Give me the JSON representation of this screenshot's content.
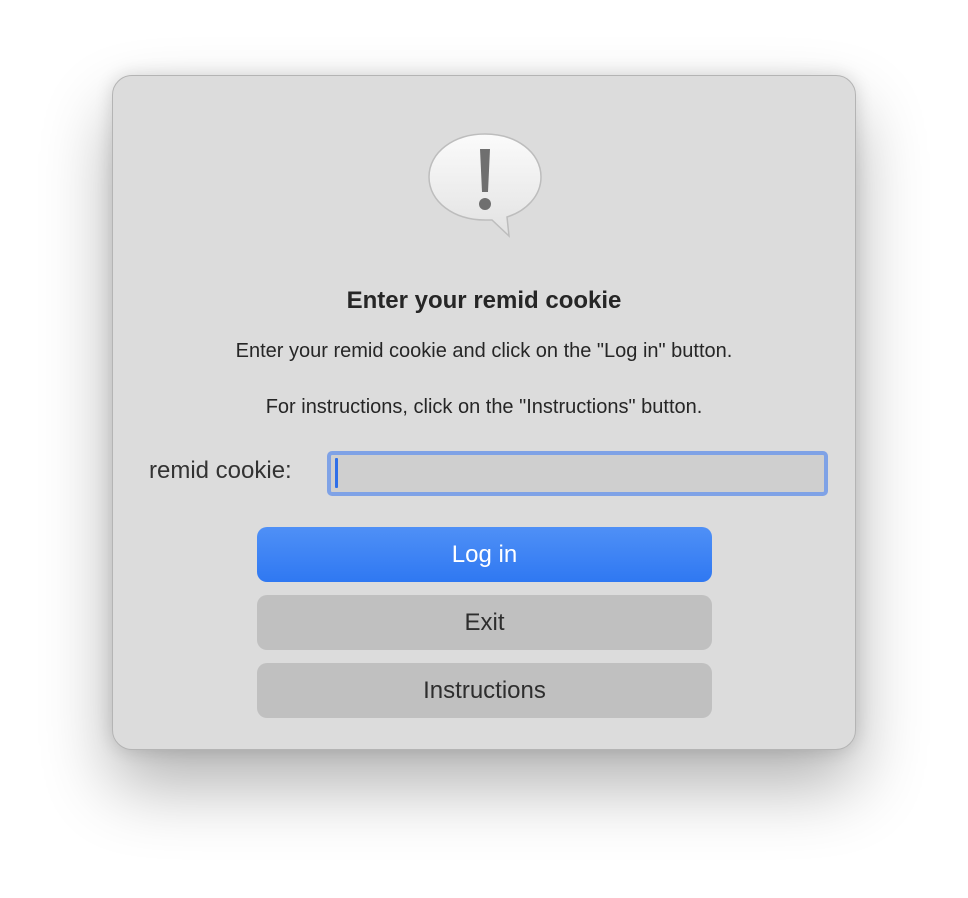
{
  "dialog": {
    "icon": "exclamation-speech-bubble-icon",
    "title": "Enter your remid cookie",
    "message_line1": "Enter your remid cookie and click on the \"Log in\" button.",
    "message_line2": "For instructions, click on the \"Instructions\" button.",
    "field": {
      "label": "remid cookie:",
      "value": "",
      "placeholder": ""
    },
    "buttons": {
      "login": "Log in",
      "exit": "Exit",
      "instructions": "Instructions"
    },
    "colors": {
      "accent": "#3a80f4",
      "focus_ring": "#7fa2e6",
      "background": "#dcdcdc",
      "secondary_button": "#c0c0c0"
    }
  }
}
